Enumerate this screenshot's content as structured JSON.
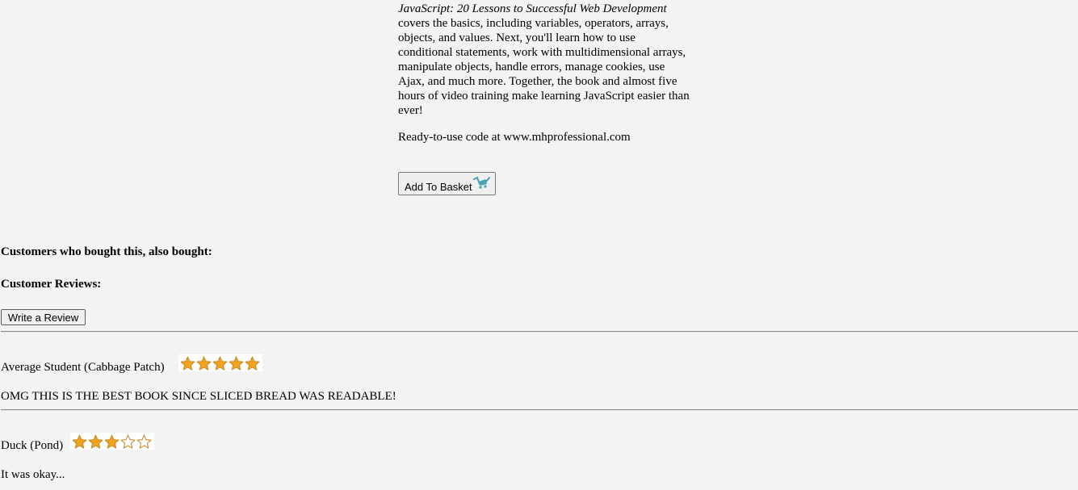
{
  "product": {
    "description_title": "JavaScript: 20 Lessons to Successful Web Development",
    "description_text": " covers the basics, including variables, operators, arrays, objects, and values. Next, you'll learn how to use conditional statements, work with multidimensional arrays, manipulate objects, handle errors, manage cookies, use Ajax, and much more. Together, the book and almost five hours of video training make learning JavaScript easier than ever!",
    "code_note": "Ready-to-use code at www.mhprofessional.com",
    "add_to_basket_label": "Add To Basket",
    "cart_icon": "shopping-cart-icon"
  },
  "also_bought_heading": "Customers who bought this, also bought:",
  "reviews": {
    "heading": "Customer Reviews:",
    "write_label": "Write a Review",
    "items": [
      {
        "author": "Average Student (Cabbage Patch)",
        "rating": 5,
        "max_rating": 5,
        "text": "OMG THIS IS THE BEST BOOK SINCE SLICED BREAD WAS READABLE!"
      },
      {
        "author": "Duck (Pond)",
        "rating": 3,
        "max_rating": 5,
        "text": "It was okay..."
      }
    ]
  },
  "colors": {
    "background": "#f3f3f3",
    "star_fill": "#f2a31e",
    "star_outline": "#c98a2a",
    "cart": "#4aa3b5"
  }
}
